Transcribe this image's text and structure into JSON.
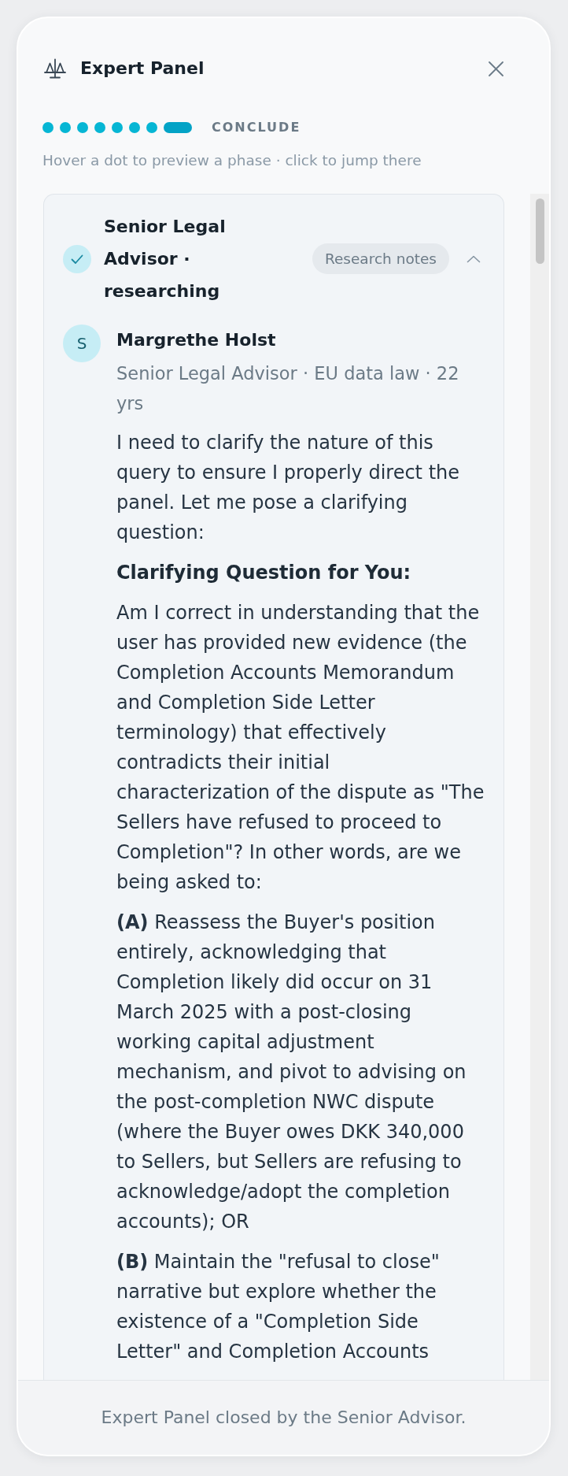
{
  "header": {
    "title": "Expert Panel"
  },
  "phase_stepper": {
    "phases": [
      {
        "selected": false
      },
      {
        "selected": false
      },
      {
        "selected": false
      },
      {
        "selected": false
      },
      {
        "selected": false
      },
      {
        "selected": false
      },
      {
        "selected": false
      },
      {
        "selected": true
      }
    ],
    "current_phase": "CONCLUDE",
    "hint": "Hover a dot to preview a phase · click to jump there"
  },
  "expert_card": {
    "completed": true,
    "title": "Senior Legal Advisor · researching",
    "badge": "Research notes",
    "expanded": true,
    "message": {
      "avatar_initial": "S",
      "author": "Margrethe Holst",
      "byline": "Senior Legal Advisor · EU data law · 22 yrs",
      "blocks": [
        {
          "kind": "paragraph",
          "text": "I need to clarify the nature of this query to ensure I properly direct the panel. Let me pose a clarifying question:"
        },
        {
          "kind": "heading",
          "text": "Clarifying Question for You:"
        },
        {
          "kind": "paragraph",
          "text": "Am I correct in understanding that the user has provided new evidence (the Completion Accounts Memorandum and Completion Side Letter terminology) that effectively contradicts their initial characterization of the dispute as \"The Sellers have refused to proceed to Completion\"? In other words, are we being asked to:"
        },
        {
          "kind": "paragraph",
          "text": "**(A)** Reassess the Buyer's position entirely, acknowledging that Completion likely did occur on 31 March 2025 with a post-closing working capital adjustment mechanism, and pivot to advising on the post-completion NWC dispute (where the Buyer owes DKK 340,000 to Sellers, but Sellers are refusing to acknowledge/adopt the completion accounts); OR"
        },
        {
          "kind": "paragraph",
          "text": "**(B)** Maintain the \"refusal to close\" narrative but explore whether the existence of a \"Completion Side Letter\" and Completion Accounts"
        }
      ]
    }
  },
  "footer": {
    "status": "Expert Panel closed by the Senior Advisor."
  }
}
